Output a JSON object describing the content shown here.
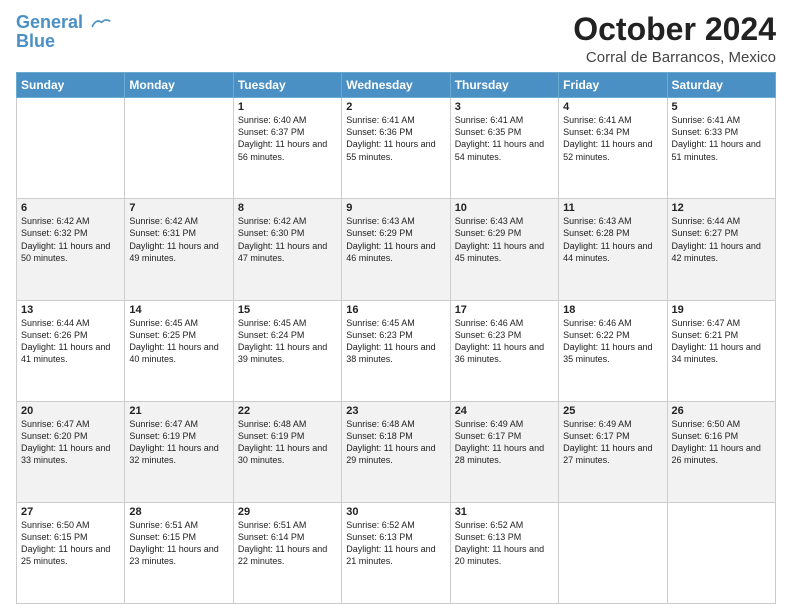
{
  "header": {
    "logo_line1": "General",
    "logo_line2": "Blue",
    "month": "October 2024",
    "location": "Corral de Barrancos, Mexico"
  },
  "days_of_week": [
    "Sunday",
    "Monday",
    "Tuesday",
    "Wednesday",
    "Thursday",
    "Friday",
    "Saturday"
  ],
  "weeks": [
    [
      {
        "day": "",
        "sunrise": "",
        "sunset": "",
        "daylight": ""
      },
      {
        "day": "",
        "sunrise": "",
        "sunset": "",
        "daylight": ""
      },
      {
        "day": "1",
        "sunrise": "Sunrise: 6:40 AM",
        "sunset": "Sunset: 6:37 PM",
        "daylight": "Daylight: 11 hours and 56 minutes."
      },
      {
        "day": "2",
        "sunrise": "Sunrise: 6:41 AM",
        "sunset": "Sunset: 6:36 PM",
        "daylight": "Daylight: 11 hours and 55 minutes."
      },
      {
        "day": "3",
        "sunrise": "Sunrise: 6:41 AM",
        "sunset": "Sunset: 6:35 PM",
        "daylight": "Daylight: 11 hours and 54 minutes."
      },
      {
        "day": "4",
        "sunrise": "Sunrise: 6:41 AM",
        "sunset": "Sunset: 6:34 PM",
        "daylight": "Daylight: 11 hours and 52 minutes."
      },
      {
        "day": "5",
        "sunrise": "Sunrise: 6:41 AM",
        "sunset": "Sunset: 6:33 PM",
        "daylight": "Daylight: 11 hours and 51 minutes."
      }
    ],
    [
      {
        "day": "6",
        "sunrise": "Sunrise: 6:42 AM",
        "sunset": "Sunset: 6:32 PM",
        "daylight": "Daylight: 11 hours and 50 minutes."
      },
      {
        "day": "7",
        "sunrise": "Sunrise: 6:42 AM",
        "sunset": "Sunset: 6:31 PM",
        "daylight": "Daylight: 11 hours and 49 minutes."
      },
      {
        "day": "8",
        "sunrise": "Sunrise: 6:42 AM",
        "sunset": "Sunset: 6:30 PM",
        "daylight": "Daylight: 11 hours and 47 minutes."
      },
      {
        "day": "9",
        "sunrise": "Sunrise: 6:43 AM",
        "sunset": "Sunset: 6:29 PM",
        "daylight": "Daylight: 11 hours and 46 minutes."
      },
      {
        "day": "10",
        "sunrise": "Sunrise: 6:43 AM",
        "sunset": "Sunset: 6:29 PM",
        "daylight": "Daylight: 11 hours and 45 minutes."
      },
      {
        "day": "11",
        "sunrise": "Sunrise: 6:43 AM",
        "sunset": "Sunset: 6:28 PM",
        "daylight": "Daylight: 11 hours and 44 minutes."
      },
      {
        "day": "12",
        "sunrise": "Sunrise: 6:44 AM",
        "sunset": "Sunset: 6:27 PM",
        "daylight": "Daylight: 11 hours and 42 minutes."
      }
    ],
    [
      {
        "day": "13",
        "sunrise": "Sunrise: 6:44 AM",
        "sunset": "Sunset: 6:26 PM",
        "daylight": "Daylight: 11 hours and 41 minutes."
      },
      {
        "day": "14",
        "sunrise": "Sunrise: 6:45 AM",
        "sunset": "Sunset: 6:25 PM",
        "daylight": "Daylight: 11 hours and 40 minutes."
      },
      {
        "day": "15",
        "sunrise": "Sunrise: 6:45 AM",
        "sunset": "Sunset: 6:24 PM",
        "daylight": "Daylight: 11 hours and 39 minutes."
      },
      {
        "day": "16",
        "sunrise": "Sunrise: 6:45 AM",
        "sunset": "Sunset: 6:23 PM",
        "daylight": "Daylight: 11 hours and 38 minutes."
      },
      {
        "day": "17",
        "sunrise": "Sunrise: 6:46 AM",
        "sunset": "Sunset: 6:23 PM",
        "daylight": "Daylight: 11 hours and 36 minutes."
      },
      {
        "day": "18",
        "sunrise": "Sunrise: 6:46 AM",
        "sunset": "Sunset: 6:22 PM",
        "daylight": "Daylight: 11 hours and 35 minutes."
      },
      {
        "day": "19",
        "sunrise": "Sunrise: 6:47 AM",
        "sunset": "Sunset: 6:21 PM",
        "daylight": "Daylight: 11 hours and 34 minutes."
      }
    ],
    [
      {
        "day": "20",
        "sunrise": "Sunrise: 6:47 AM",
        "sunset": "Sunset: 6:20 PM",
        "daylight": "Daylight: 11 hours and 33 minutes."
      },
      {
        "day": "21",
        "sunrise": "Sunrise: 6:47 AM",
        "sunset": "Sunset: 6:19 PM",
        "daylight": "Daylight: 11 hours and 32 minutes."
      },
      {
        "day": "22",
        "sunrise": "Sunrise: 6:48 AM",
        "sunset": "Sunset: 6:19 PM",
        "daylight": "Daylight: 11 hours and 30 minutes."
      },
      {
        "day": "23",
        "sunrise": "Sunrise: 6:48 AM",
        "sunset": "Sunset: 6:18 PM",
        "daylight": "Daylight: 11 hours and 29 minutes."
      },
      {
        "day": "24",
        "sunrise": "Sunrise: 6:49 AM",
        "sunset": "Sunset: 6:17 PM",
        "daylight": "Daylight: 11 hours and 28 minutes."
      },
      {
        "day": "25",
        "sunrise": "Sunrise: 6:49 AM",
        "sunset": "Sunset: 6:17 PM",
        "daylight": "Daylight: 11 hours and 27 minutes."
      },
      {
        "day": "26",
        "sunrise": "Sunrise: 6:50 AM",
        "sunset": "Sunset: 6:16 PM",
        "daylight": "Daylight: 11 hours and 26 minutes."
      }
    ],
    [
      {
        "day": "27",
        "sunrise": "Sunrise: 6:50 AM",
        "sunset": "Sunset: 6:15 PM",
        "daylight": "Daylight: 11 hours and 25 minutes."
      },
      {
        "day": "28",
        "sunrise": "Sunrise: 6:51 AM",
        "sunset": "Sunset: 6:15 PM",
        "daylight": "Daylight: 11 hours and 23 minutes."
      },
      {
        "day": "29",
        "sunrise": "Sunrise: 6:51 AM",
        "sunset": "Sunset: 6:14 PM",
        "daylight": "Daylight: 11 hours and 22 minutes."
      },
      {
        "day": "30",
        "sunrise": "Sunrise: 6:52 AM",
        "sunset": "Sunset: 6:13 PM",
        "daylight": "Daylight: 11 hours and 21 minutes."
      },
      {
        "day": "31",
        "sunrise": "Sunrise: 6:52 AM",
        "sunset": "Sunset: 6:13 PM",
        "daylight": "Daylight: 11 hours and 20 minutes."
      },
      {
        "day": "",
        "sunrise": "",
        "sunset": "",
        "daylight": ""
      },
      {
        "day": "",
        "sunrise": "",
        "sunset": "",
        "daylight": ""
      }
    ]
  ]
}
